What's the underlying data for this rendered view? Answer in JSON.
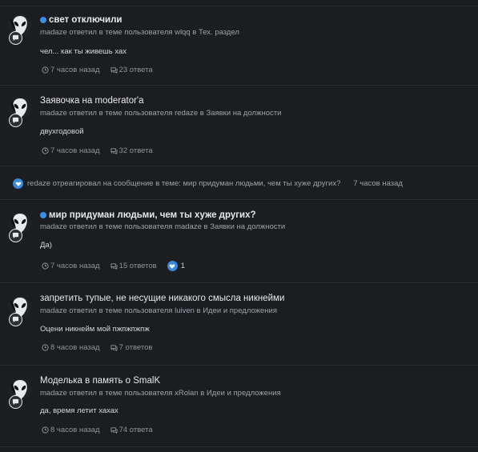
{
  "posts": [
    {
      "title": "свет отключили",
      "unread": true,
      "meta": "madaze ответил в теме пользователя wlqq в Тех. раздел",
      "snippet": "чел... как ты живешь хах",
      "time": "7 часов назад",
      "replies": "23 ответа"
    },
    {
      "title": "Заявочка на moderator'a",
      "unread": false,
      "meta": "madaze ответил в теме пользователя redaze в Заявки на должности",
      "snippet": "двухгодовой",
      "time": "7 часов назад",
      "replies": "32 ответа"
    },
    {
      "title": "мир придуман людьми, чем ты хуже других?",
      "unread": true,
      "meta": "madaze ответил в теме пользователя madaze в Заявки на должности",
      "snippet": "Да)",
      "time": "7 часов назад",
      "replies": "15 ответов",
      "reactions": "1"
    },
    {
      "title": "запретить тупые, не несущие никакого смысла никнейми",
      "unread": false,
      "meta": "madaze ответил в теме пользователя luiven в Идеи и предложения",
      "snippet": "Оцени никнейм мой пжпжпжпж",
      "time": "8 часов назад",
      "replies": "7 ответов"
    },
    {
      "title": "Моделька в память о SmalK",
      "unread": false,
      "meta": "madaze ответил в теме пользователя xRolan в Идеи и предложения",
      "snippet": "да, время летит хахах",
      "time": "8 часов назад",
      "replies": "74 ответа"
    }
  ],
  "activity": {
    "text": "redaze отреагировал на сообщение в теме: мир придуман людьми, чем ты хуже других?",
    "time": "7 часов назад",
    "icon": "heart-icon"
  },
  "colors": {
    "background": "#1b1d20",
    "unread_dot": "#3b8ee8",
    "reaction": "#3a88d8",
    "separator": "#2b2e33"
  }
}
